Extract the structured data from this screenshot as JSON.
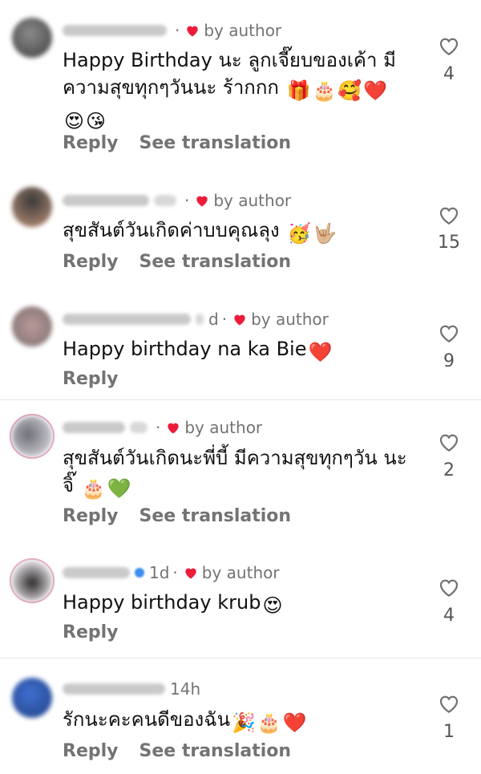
{
  "author_badge": "by author",
  "reply_label": "Reply",
  "translate_label": "See translation",
  "comments": [
    {
      "time": "",
      "text_lines": [
        "Happy Birthday นะ ลูกเจี๊ยบของเค้า มี",
        "ความสุขทุกๆวันนะ ร้ากกก"
      ],
      "emojis": [
        "gift-emoji",
        "cake-emoji",
        "smiling-hearts-emoji",
        "red-heart-emoji"
      ],
      "emojis2": [
        "heart-eyes-emoji",
        "kissing-emoji"
      ],
      "likes": "4",
      "by_author": true,
      "translate": true
    },
    {
      "time": "",
      "text_lines": [
        "สุขสันต์วันเกิดค่าบบคุณลุง"
      ],
      "emojis": [
        "partying-face-emoji",
        "love-you-gesture-emoji"
      ],
      "likes": "15",
      "by_author": true,
      "translate": true
    },
    {
      "time": "d",
      "text_lines": [
        "Happy birthday na ka Bie"
      ],
      "emojis": [
        "red-heart-emoji"
      ],
      "likes": "9",
      "by_author": true,
      "translate": false
    },
    {
      "time": "",
      "text_lines": [
        "สุขสันต์วันเกิดนะพี่บี้ มีความสุขทุกๆวัน นะ",
        "จิ๊"
      ],
      "emojis2": [
        "cake-emoji",
        "green-heart-emoji"
      ],
      "likes": "2",
      "by_author": true,
      "translate": true
    },
    {
      "time": "1d",
      "text_lines": [
        "Happy birthday krub"
      ],
      "emojis": [
        "heart-eyes-emoji"
      ],
      "likes": "4",
      "by_author": true,
      "translate": false
    },
    {
      "time": "14h",
      "text_lines": [
        "รักนะคะคนดีของฉัน"
      ],
      "emojis": [
        "party-popper-emoji",
        "cake-emoji",
        "red-heart-emoji"
      ],
      "likes": "1",
      "by_author": false,
      "translate": true
    }
  ]
}
